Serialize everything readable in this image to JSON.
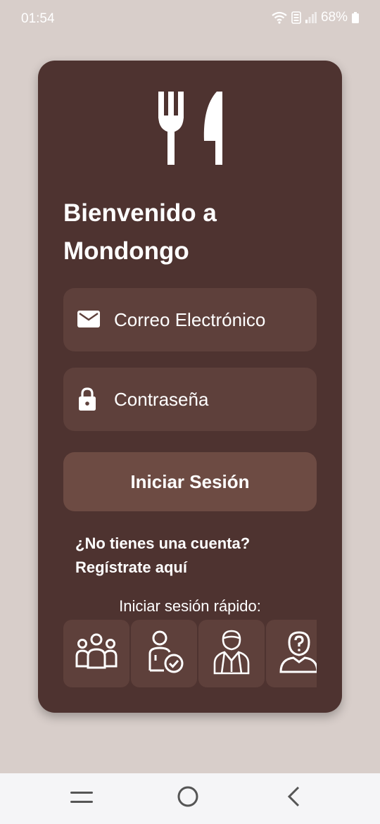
{
  "status_bar": {
    "time": "01:54",
    "battery": "68%",
    "icons": [
      "wifi-icon",
      "volte-icon",
      "signal-icon",
      "battery-icon"
    ]
  },
  "login": {
    "logo_icon": "cutlery-icon",
    "welcome_line1": "Bienvenido a",
    "welcome_line2": "Mondongo",
    "email_placeholder": "Correo Electrónico",
    "email_icon": "envelope-icon",
    "password_placeholder": "Contraseña",
    "password_icon": "lock-icon",
    "login_button": "Iniciar Sesión",
    "register_line1": "¿No tienes una cuenta?",
    "register_line2": "Regístrate aquí",
    "quick_login_label": "Iniciar sesión rápido:",
    "quick_login_icons": [
      "group-icon",
      "verified-user-icon",
      "waiter-icon",
      "unknown-user-icon"
    ]
  },
  "nav_bar": {
    "icons": [
      "recent-apps-icon",
      "home-icon",
      "back-icon"
    ]
  },
  "colors": {
    "background": "#d8ceca",
    "card": "#4e3330",
    "field": "#5e403b",
    "button": "#6d4b43",
    "text": "#ffffff"
  }
}
